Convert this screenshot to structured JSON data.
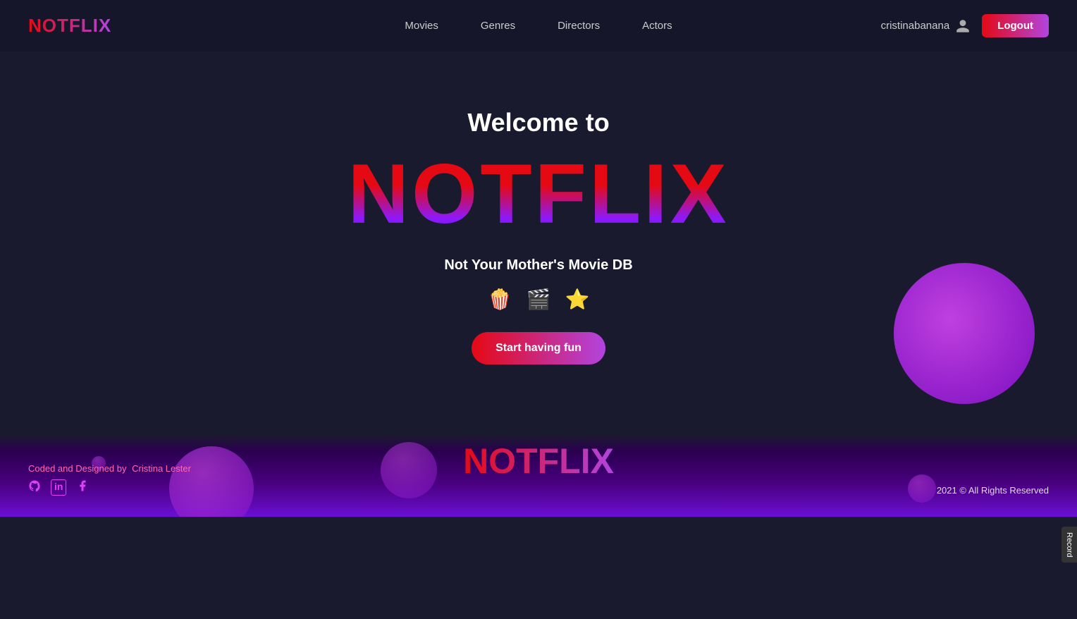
{
  "nav": {
    "logo": "NOTFLIX",
    "links": [
      {
        "label": "Movies",
        "href": "#"
      },
      {
        "label": "Genres",
        "href": "#"
      },
      {
        "label": "Directors",
        "href": "#"
      },
      {
        "label": "Actors",
        "href": "#"
      }
    ],
    "username": "cristinabanana",
    "logout_label": "Logout"
  },
  "hero": {
    "welcome": "Welcome to",
    "logo": "NOTFLIX",
    "tagline": "Not Your Mother's Movie DB",
    "emojis": [
      "🍿",
      "🎬",
      "⭐"
    ],
    "cta_label": "Start having fun"
  },
  "footer": {
    "credit_text": "Coded and Designed by",
    "credit_name": "Cristina Lester",
    "logo": "NOTFLIX",
    "copyright": "2021 © All Rights Reserved",
    "social_links": [
      {
        "name": "github",
        "icon": "⊞",
        "href": "#"
      },
      {
        "name": "linkedin",
        "icon": "in",
        "href": "#"
      },
      {
        "name": "facebook",
        "icon": "f",
        "href": "#"
      }
    ]
  },
  "record_tab": {
    "label": "Record"
  }
}
